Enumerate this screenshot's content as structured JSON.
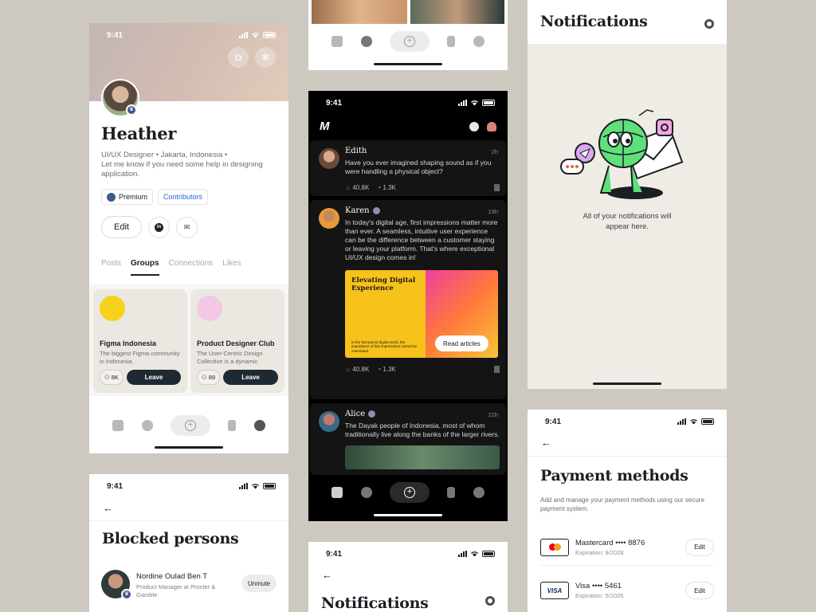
{
  "profile": {
    "time": "9:41",
    "name": "Heather",
    "meta_line1": "UI/UX Designer  •  Jakarta, Indonesia  •",
    "meta_line2": "Let me know if you need some help in designing application.",
    "chip_premium": "Premium",
    "chip_contributors": "Contributors",
    "edit_label": "Edit",
    "tabs": [
      "Posts",
      "Groups",
      "Connections",
      "Likes"
    ],
    "groups": [
      {
        "name": "Figma Indonesia",
        "desc": "The biggest Figma community in Indonesia.",
        "members": "8K",
        "action": "Leave"
      },
      {
        "name": "Product Designer Club",
        "desc": "The User-Centric Design Collective is a dynamic group...",
        "members": "89",
        "action": "Leave"
      }
    ]
  },
  "feed": {
    "time": "9:41",
    "logo": "M",
    "posts": [
      {
        "name": "Edith",
        "time": "2h",
        "text": "Have you ever imagined shaping sound as if you were handling a physical object?",
        "likes": "40.8K",
        "comments": "1.3K"
      },
      {
        "name": "Karen",
        "time": "19h",
        "text": "In today's digital age, first impressions matter more than ever. A seamless, intuitive user experience can be the difference between a customer staying or leaving your platform. That's where exceptional UI/UX design comes in!",
        "media_title": "Elevating Digital Experience",
        "media_small": "In the fast-paced digital world, the importance of first impressions cannot be overstated.",
        "media_button": "Read articles",
        "likes": "40.8K",
        "comments": "1.3K"
      },
      {
        "name": "Alice",
        "time": "22h",
        "text": "The Dayak people of Indonesia, most of whom traditionally live along the banks of the larger rivers."
      }
    ]
  },
  "notifications": {
    "title": "Notifications",
    "empty_line1": "All of your notifications will",
    "empty_line2": "appear here."
  },
  "payment": {
    "time": "9:41",
    "title": "Payment methods",
    "desc": "Add and manage your payment methods using our secure payment system.",
    "cards": [
      {
        "brand": "Mastercard •••• 8876",
        "exp": "Expiration: 9/2028",
        "action": "Edit"
      },
      {
        "brand": "Visa •••• 5461",
        "exp": "Expiration: 5/2026",
        "action": "Edit",
        "logo": "VISA"
      }
    ]
  },
  "blocked": {
    "time": "9:41",
    "title": "Blocked persons",
    "person": {
      "name": "Nordine Oulad Ben T",
      "role": "Product Manager at Procter & Gamble",
      "action": "Unmute"
    }
  },
  "notifications2": {
    "time": "9:41",
    "title": "Notifications"
  },
  "colors": {
    "background": "#cdc8c0",
    "dark_button": "#1e2a33",
    "link_blue": "#2a66c9",
    "fire": "#e36a3c"
  }
}
